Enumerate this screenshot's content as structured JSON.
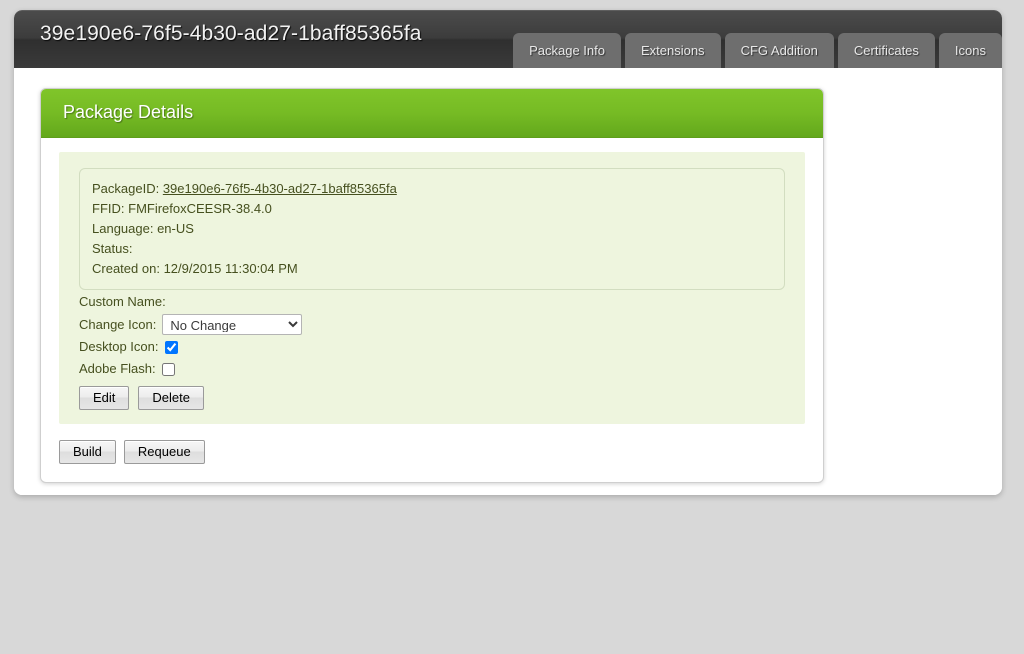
{
  "header": {
    "title": "39e190e6-76f5-4b30-ad27-1baff85365fa",
    "tabs": [
      {
        "label": "Package Info"
      },
      {
        "label": "Extensions"
      },
      {
        "label": "CFG Addition"
      },
      {
        "label": "Certificates"
      },
      {
        "label": "Icons"
      }
    ]
  },
  "panel": {
    "title": "Package Details",
    "info": {
      "package_id_label": "PackageID:",
      "package_id_value": "39e190e6-76f5-4b30-ad27-1baff85365fa",
      "ffid_label": "FFID:",
      "ffid_value": "FMFirefoxCEESR-38.4.0",
      "language_label": "Language:",
      "language_value": "en-US",
      "status_label": "Status:",
      "status_value": "",
      "created_label": "Created on:",
      "created_value": "12/9/2015 11:30:04 PM"
    },
    "form": {
      "custom_name_label": "Custom Name:",
      "custom_name_value": "",
      "change_icon_label": "Change Icon:",
      "change_icon_selected": "No Change",
      "change_icon_options": [
        "No Change"
      ],
      "desktop_icon_label": "Desktop Icon:",
      "desktop_icon_checked": true,
      "adobe_flash_label": "Adobe Flash:",
      "adobe_flash_checked": false,
      "edit_label": "Edit",
      "delete_label": "Delete"
    }
  },
  "actions": {
    "build_label": "Build",
    "requeue_label": "Requeue"
  },
  "colors": {
    "page_background": "#d8d8d8",
    "header_dark": "#3a3a3a",
    "tab_gray": "#6e6e6e",
    "panel_green_top": "#80c52a",
    "panel_green_bottom": "#63a81c",
    "content_green": "#eef5de",
    "text_olive": "#46501f"
  }
}
